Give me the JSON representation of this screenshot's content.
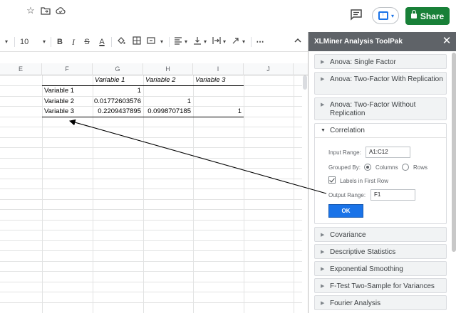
{
  "topbar": {
    "icons": [
      "star-icon",
      "move-to-folder-icon",
      "cloud-status-icon"
    ],
    "share_label": "Share"
  },
  "toolbar": {
    "font_size": "10",
    "items": [
      "bold-icon",
      "italic-icon",
      "strikethrough-icon",
      "text-color-icon",
      "fill-color-icon",
      "borders-icon",
      "merge-cells-icon",
      "align-horizontal-icon",
      "align-vertical-icon",
      "text-wrap-icon",
      "text-rotate-icon",
      "more-icon",
      "collapse-icon"
    ],
    "bold": "B",
    "italic": "I",
    "strike": "S",
    "textcolor": "A",
    "more": "⋯"
  },
  "columns": [
    "E",
    "F",
    "G",
    "H",
    "I",
    "J"
  ],
  "sheet": {
    "header_row": [
      "",
      "Variable 1",
      "Variable 2",
      "Variable 3"
    ],
    "rows": [
      {
        "label": "Variable 1",
        "values": [
          "1",
          "",
          ""
        ]
      },
      {
        "label": "Variable 2",
        "values": [
          "0.01772603576",
          "1",
          ""
        ]
      },
      {
        "label": "Variable 3",
        "values": [
          "0.2209437895",
          "0.0998707185",
          "1"
        ]
      }
    ]
  },
  "panel": {
    "title": "XLMiner Analysis ToolPak",
    "items_before": [
      "Anova: Single Factor",
      "Anova: Two-Factor With Replication",
      "Anova: Two-Factor Without Replication"
    ],
    "open_item": {
      "title": "Correlation",
      "input_range_label": "Input Range:",
      "input_range_value": "A1:C12",
      "grouped_by_label": "Grouped By:",
      "columns_label": "Columns",
      "rows_label": "Rows",
      "grouped_by_selected": "Columns",
      "labels_first_row_label": "Labels in First Row",
      "labels_first_row_checked": true,
      "output_range_label": "Output Range:",
      "output_range_value": "F1",
      "ok_label": "OK"
    },
    "items_after": [
      "Covariance",
      "Descriptive Statistics",
      "Exponential Smoothing",
      "F-Test Two-Sample for Variances",
      "Fourier Analysis"
    ]
  }
}
